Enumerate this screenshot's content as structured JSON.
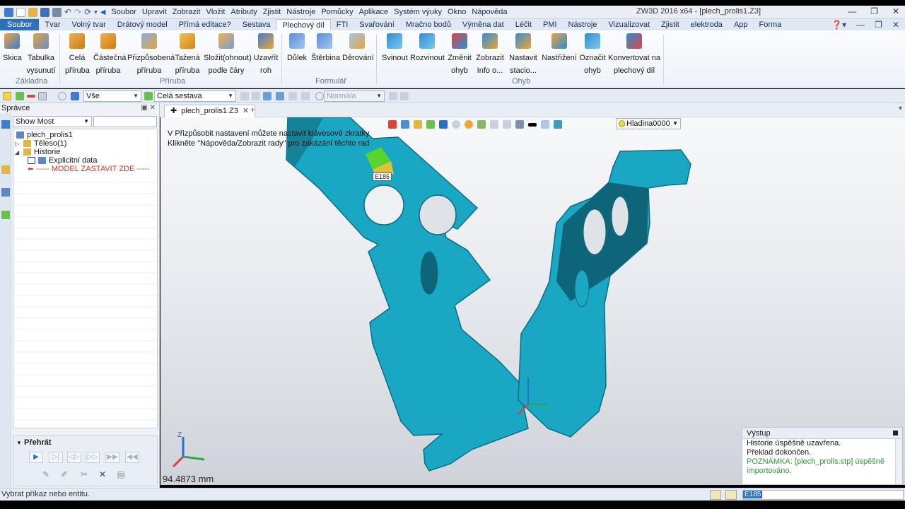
{
  "titlebar": {
    "menu": [
      "Soubor",
      "Upravit",
      "Zobrazit",
      "Vložit",
      "Atributy",
      "Zjistit",
      "Nástroje",
      "Pomůcky",
      "Aplikace",
      "Systém výuky",
      "Okno",
      "Nápověda"
    ],
    "app_title": "ZW3D 2016  x64 - [plech_prolis1.Z3]"
  },
  "ribbon_tabs": [
    "Soubor",
    "Tvar",
    "Volný tvar",
    "Drátový model",
    "Přímá editace?",
    "Sestava",
    "Plechový díl",
    "FTI",
    "Svařování",
    "Mračno bodů",
    "Výměna dat",
    "Léčit",
    "PMI",
    "Nástroje",
    "Vizualizovat",
    "Zjistit",
    "elektroda",
    "App",
    "Forma"
  ],
  "ribbon": {
    "buttons": [
      {
        "l1": "Skica",
        "l2": ""
      },
      {
        "l1": "Tabulka",
        "l2": "vysunutí"
      },
      {
        "l1": "Celá",
        "l2": "příruba"
      },
      {
        "l1": "Částečná",
        "l2": "příruba"
      },
      {
        "l1": "Přizpůsobená",
        "l2": "příruba"
      },
      {
        "l1": "Tažená",
        "l2": "příruba"
      },
      {
        "l1": "Složit(ohnout)",
        "l2": "podle čáry"
      },
      {
        "l1": "Uzavřít",
        "l2": "roh"
      },
      {
        "l1": "Důlek",
        "l2": ""
      },
      {
        "l1": "Štěrbina",
        "l2": ""
      },
      {
        "l1": "Děrování",
        "l2": ""
      },
      {
        "l1": "Svinout",
        "l2": ""
      },
      {
        "l1": "Rozvinout",
        "l2": ""
      },
      {
        "l1": "Změnit",
        "l2": "ohyb"
      },
      {
        "l1": "Zobrazit",
        "l2": "Info o..."
      },
      {
        "l1": "Nastavit",
        "l2": "stacio..."
      },
      {
        "l1": "Nastřižení",
        "l2": ""
      },
      {
        "l1": "Označit",
        "l2": "ohyb"
      },
      {
        "l1": "Konvertovat na",
        "l2": "plechový díl"
      }
    ],
    "groups": [
      "Základna",
      "Příruba",
      "Formulář",
      "Ohyb"
    ]
  },
  "cmdbar": {
    "filter": "Vše",
    "scope": "Celá sestava",
    "mode": "Normála"
  },
  "manager": {
    "title": "Správce",
    "filter": "Show Most",
    "tree": {
      "root": "plech_prolis1",
      "body": "Těleso(1)",
      "history": "Historie",
      "explicit": "Explicitní data",
      "stop": "----- MODEL ZASTAVIT ZDE -----"
    },
    "playback_title": "Přehrát"
  },
  "document": {
    "tab_label": "plech_prolis1.Z3",
    "hint_line1": "V Přizpůsobit nastavení můžete nastavit klávesové zkratky",
    "hint_line2": "Klikněte \"Nápověda/Zobrazit rady\" pro zakázání těchto rad",
    "layer": "Hladina0000",
    "scale": "94.4873 mm",
    "tooltip": "E185"
  },
  "output": {
    "title": "Výstup",
    "lines": [
      "Historie úspěšně uzavřena.",
      "Překlad dokončen.",
      "POZNÁMKA: [plech_prolis.stp] úspěšně",
      "importováno."
    ]
  },
  "status": {
    "text": "Vybrat příkaz nebo entitu.",
    "field": "E185"
  },
  "colors": {
    "part": "#1aa7c3",
    "accent": "#2e6fc0",
    "highlight": "#59d42e"
  }
}
